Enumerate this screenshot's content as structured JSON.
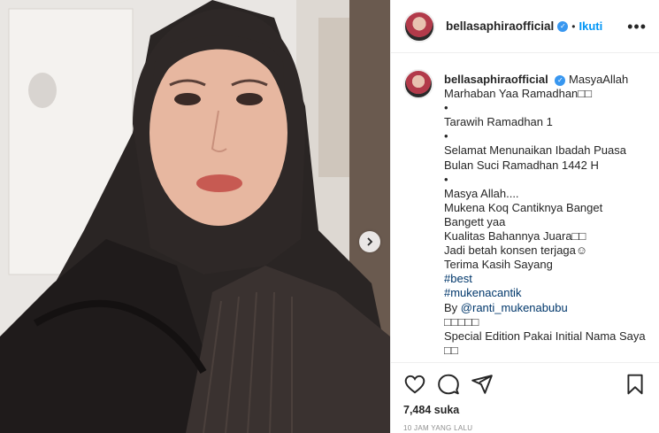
{
  "header": {
    "username": "bellasaphiraofficial",
    "separator": "•",
    "follow_label": "Ikuti",
    "more_label": "•••"
  },
  "caption": {
    "username": "bellasaphiraofficial",
    "lines": [
      "MasyaAllah",
      "Marhaban Yaa Ramadhan□□",
      "•",
      "Tarawih Ramadhan 1",
      "•",
      "Selamat Menunaikan Ibadah Puasa",
      "Bulan Suci Ramadhan 1442 H",
      "•",
      "Masya Allah....",
      "Mukena Koq Cantiknya Banget",
      "Bangett yaa",
      "Kualitas Bahannya Juara□□",
      "Jadi betah konsen terjaga☺",
      "Terima Kasih Sayang",
      "#best",
      "#mukenacantik",
      "By ",
      "□□□□□",
      "Special Edition Pakai Initial Nama Saya",
      "□□"
    ],
    "mention": "@ranti_mukenabubu"
  },
  "stats": {
    "likes": "7,484 suka",
    "time": "10 JAM YANG LALU"
  },
  "icons": {
    "verified": "verified-badge-icon",
    "like": "heart-icon",
    "comment": "comment-icon",
    "share": "paper-plane-icon",
    "save": "bookmark-icon",
    "next": "chevron-right-icon"
  },
  "colors": {
    "link": "#00376b",
    "follow": "#0095f6",
    "verified": "#3897f0",
    "muted": "#8e8e8e"
  }
}
